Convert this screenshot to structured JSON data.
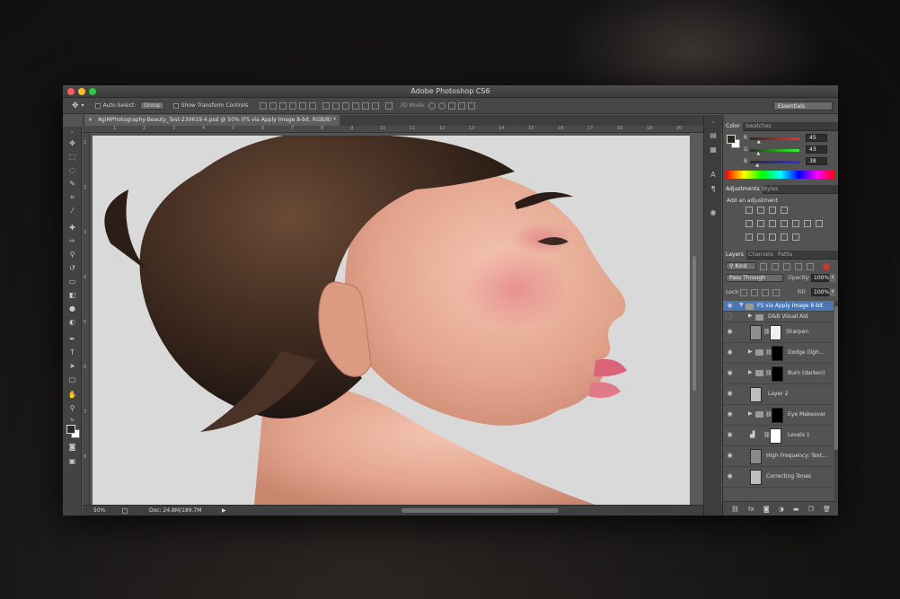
{
  "window": {
    "title": "Adobe Photoshop CS6"
  },
  "options": {
    "auto_select_label": "Auto-Select:",
    "auto_select_value": "Group",
    "transform_label": "Show Transform Controls",
    "mode_3d_label": "3D Mode:",
    "workspace": "Essentials"
  },
  "document": {
    "tab": "AgiMPhotography-Beauty_Test-230619-4.psd @ 50% (FS via Apply Image 8-bit, RGB/8) *"
  },
  "status": {
    "zoom": "50%",
    "doc": "Doc: 24.8M/189.7M"
  },
  "ruler": {
    "h_ticks": [
      "1",
      "2",
      "3",
      "4",
      "5",
      "6",
      "7",
      "8",
      "9",
      "10",
      "11",
      "12",
      "13",
      "14",
      "15",
      "16",
      "17",
      "18",
      "19",
      "20",
      "21"
    ]
  },
  "color_panel": {
    "tabs": [
      "Color",
      "Swatches"
    ],
    "r_label": "R",
    "g_label": "G",
    "b_label": "B",
    "r": "45",
    "g": "43",
    "b": "38",
    "r_level": 0.18,
    "g_level": 0.17,
    "b_level": 0.15
  },
  "adjustments_panel": {
    "tabs": [
      "Adjustments",
      "Styles"
    ],
    "heading": "Add an adjustment"
  },
  "layers_panel": {
    "tabs": [
      "Layers",
      "Channels",
      "Paths"
    ],
    "filter": "Kind",
    "blend_mode": "Pass Through",
    "opacity_label": "Opacity:",
    "opacity": "100%",
    "lock_label": "Lock:",
    "fill_label": "Fill:",
    "fill": "100%",
    "layers": [
      {
        "name": "FS via Apply Image 8-bit"
      },
      {
        "name": "D&B Visual Aid"
      },
      {
        "name": "Sharpen"
      },
      {
        "name": "Dodge (ligh..."
      },
      {
        "name": "Burn (darken)"
      },
      {
        "name": "Layer 2"
      },
      {
        "name": "Eye Makeover"
      },
      {
        "name": "Levels 1"
      },
      {
        "name": "High Frequency: Text..."
      },
      {
        "name": "Correcting Tones"
      }
    ]
  },
  "colors": {
    "accent": "#4a78b5",
    "panel": "#535353",
    "dark": "#3a3a3a"
  }
}
